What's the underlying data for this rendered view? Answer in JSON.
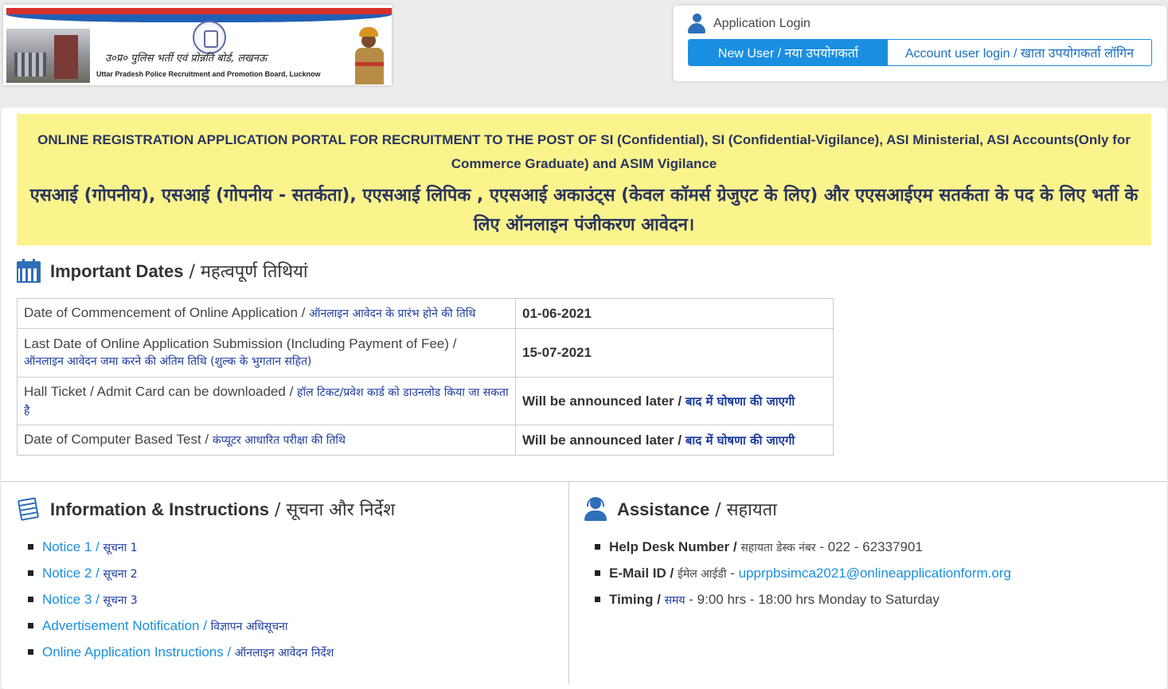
{
  "header": {
    "logo_hindi": "उ०प्र० पुलिस भर्ती एवं प्रोन्नति बोर्ड, लखनऊ",
    "logo_english": "Uttar Pradesh Police Recruitment and Promotion Board, Lucknow"
  },
  "login": {
    "title": "Application Login",
    "new_user_label": "New User / नया उपयोगकर्ता",
    "account_login_label": "Account user login / खाता उपयोगकर्ता लॉगिन"
  },
  "banner": {
    "english": "ONLINE REGISTRATION APPLICATION PORTAL FOR RECRUITMENT TO THE POST OF SI (Confidential), SI (Confidential-Vigilance), ASI Ministerial, ASI Accounts(Only for Commerce Graduate) and ASIM Vigilance",
    "hindi": "एसआई (गोपनीय), एसआई (गोपनीय - सतर्कता), एएसआई लिपिक , एएसआई अकाउंट्स (केवल कॉमर्स ग्रेजुएट के लिए) और एएसआईएम सतर्कता के पद के लिए भर्ती के लिए ऑनलाइन पंजीकरण आवेदन।"
  },
  "important_dates": {
    "title_en": "Important Dates",
    "title_hi": " / महत्वपूर्ण तिथियां",
    "rows": [
      {
        "label_en": "Date of Commencement of Online Application / ",
        "label_hi": "ऑनलाइन आवेदन के प्रारंभ होने की तिथि",
        "value_en": "01-06-2021",
        "value_hi": ""
      },
      {
        "label_en": "Last Date of Online Application Submission (Including Payment of Fee) / ",
        "label_hi": "ऑनलाइन आवेदन जमा करने की अंतिम तिथि (शुल्क के भुगतान सहित)",
        "value_en": "15-07-2021",
        "value_hi": ""
      },
      {
        "label_en": "Hall Ticket / Admit Card can be downloaded / ",
        "label_hi": "हॉल टिकट/प्रवेश कार्ड को डाउनलोड किया जा सकता है",
        "value_en": "Will be announced later / ",
        "value_hi": "बाद में घोषणा की जाएगी"
      },
      {
        "label_en": "Date of Computer Based Test / ",
        "label_hi": "कंप्यूटर आधारित परीक्षा की तिथि",
        "value_en": "Will be announced later / ",
        "value_hi": "बाद में घोषणा की जाएगी"
      }
    ]
  },
  "information": {
    "title_en": "Information & Instructions",
    "title_hi": " / सूचना और निर्देश",
    "items": [
      {
        "en": "Notice 1 / ",
        "hi": "सूचना 1"
      },
      {
        "en": "Notice 2 / ",
        "hi": "सूचना 2"
      },
      {
        "en": "Notice 3 / ",
        "hi": "सूचना 3"
      },
      {
        "en": "Advertisement Notification / ",
        "hi": "विज्ञापन अधिसूचना"
      },
      {
        "en": "Online Application Instructions / ",
        "hi": "ऑनलाइन आवेदन निर्देश"
      }
    ]
  },
  "assistance": {
    "title_en": "Assistance",
    "title_hi": " / सहायता",
    "helpdesk_label": "Help Desk Number / ",
    "helpdesk_hi": "सहायता डेस्क नंबर",
    "helpdesk_value": " - 022 - 62337901",
    "email_label": "E-Mail ID / ",
    "email_hi": "ईमेल आईडी",
    "email_sep": " - ",
    "email_value": "upprpbsimca2021@onlineapplicationform.org",
    "timing_label": "Timing / ",
    "timing_hi": "समय",
    "timing_value": " - 9:00 hrs - 18:00 hrs Monday to Saturday"
  }
}
